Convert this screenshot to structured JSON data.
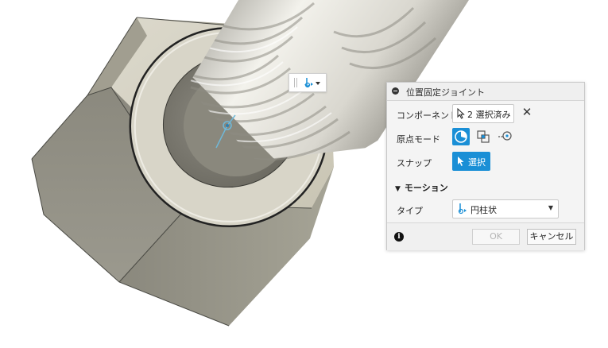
{
  "dialog": {
    "title": "位置固定ジョイント",
    "component_label": "コンポーネント",
    "component_value": "2 選択済み",
    "origin_mode_label": "原点モード",
    "snap_label": "スナップ",
    "snap_value": "選択",
    "motion_header": "モーション",
    "type_label": "タイプ",
    "type_value": "円柱状",
    "ok_label": "OK",
    "cancel_label": "キャンセル",
    "info_glyph": "i",
    "clear_glyph": "✕"
  },
  "icons": {
    "mini_toolbar": "cylindrical-joint-icon",
    "origin_modes": [
      "origin-simple-icon",
      "origin-between-two-faces-icon",
      "origin-two-edge-intersection-icon"
    ]
  },
  "colors": {
    "accent": "#1a8fd6",
    "model": "#b4b0a2",
    "disabled_text": "#b5b5b5"
  }
}
